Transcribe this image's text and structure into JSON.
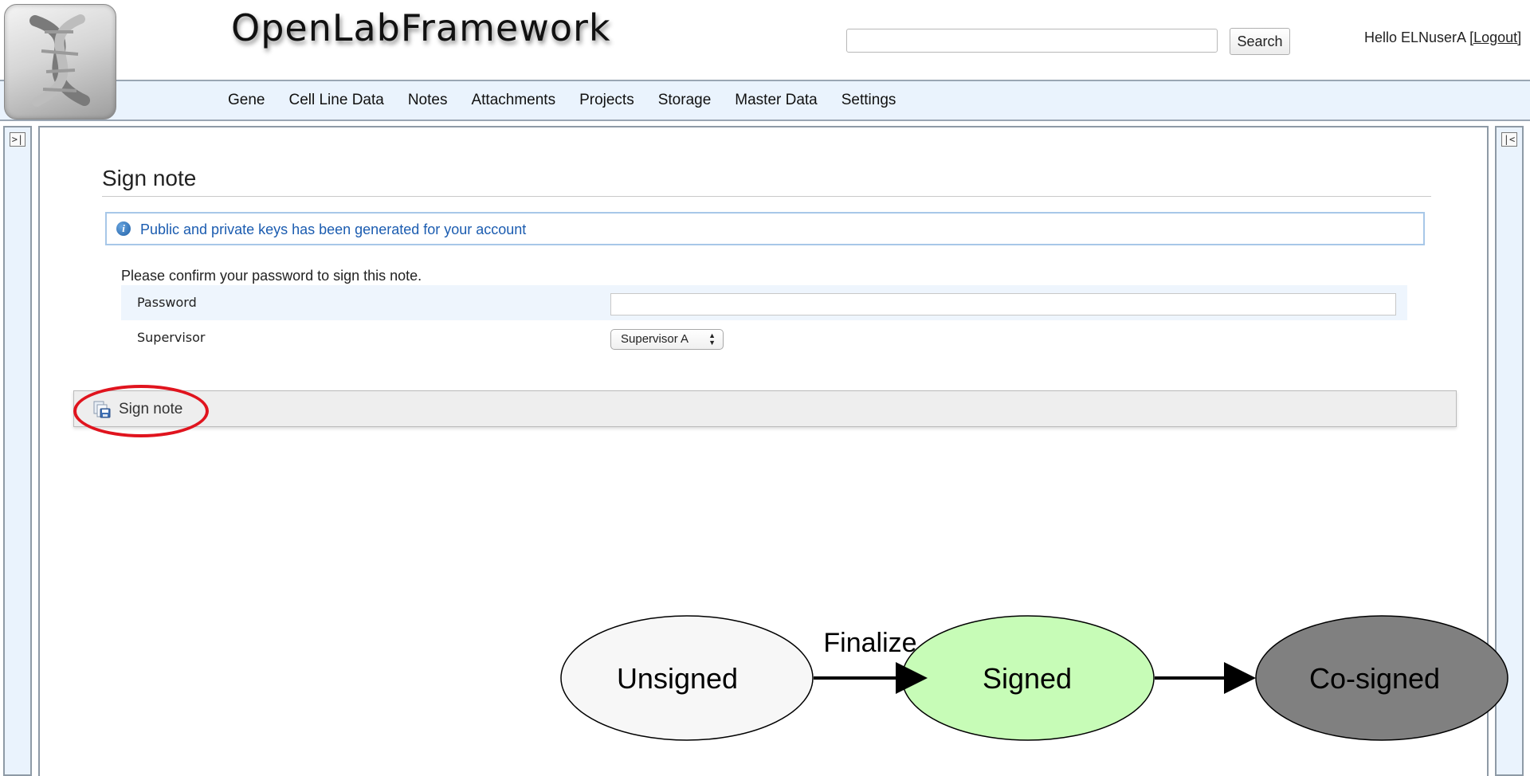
{
  "app": {
    "title": "OpenLabFramework"
  },
  "header": {
    "search": {
      "value": "",
      "placeholder": "",
      "button_label": "Search"
    },
    "greeting": "Hello ELNuserA ",
    "logout_label": "[Logout]"
  },
  "nav": {
    "items": [
      "Gene",
      "Cell Line Data",
      "Notes",
      "Attachments",
      "Projects",
      "Storage",
      "Master Data",
      "Settings"
    ]
  },
  "side_panels": {
    "left_toggle": ">|",
    "right_toggle": "|<"
  },
  "page": {
    "title": "Sign note",
    "info_message": "Public and private keys has been generated for your account",
    "confirm_text": "Please confirm your password to sign this note.",
    "form": {
      "password_label": "Password",
      "password_value": "",
      "supervisor_label": "Supervisor",
      "supervisor_value": "Supervisor A"
    },
    "toolbar": {
      "sign_button_label": "Sign note"
    }
  },
  "colors": {
    "highlight": "#e0141e",
    "unsigned_fill": "#f7f7f7",
    "signed_fill": "#c7fcb7",
    "cosigned_fill": "#808080",
    "info_text": "#1b5cb0",
    "nav_background": "#eaf3fd"
  },
  "state_diagram": {
    "states": [
      "Unsigned",
      "Signed",
      "Co-signed"
    ],
    "transitions": [
      {
        "from": "Unsigned",
        "to": "Signed",
        "label": "Finalize"
      },
      {
        "from": "Signed",
        "to": "Co-signed",
        "label": ""
      }
    ]
  },
  "icons": {
    "logo": "dna-helix-logo",
    "info": "info-icon",
    "sign": "sign-document-icon",
    "select": "up-down-arrows-icon"
  }
}
